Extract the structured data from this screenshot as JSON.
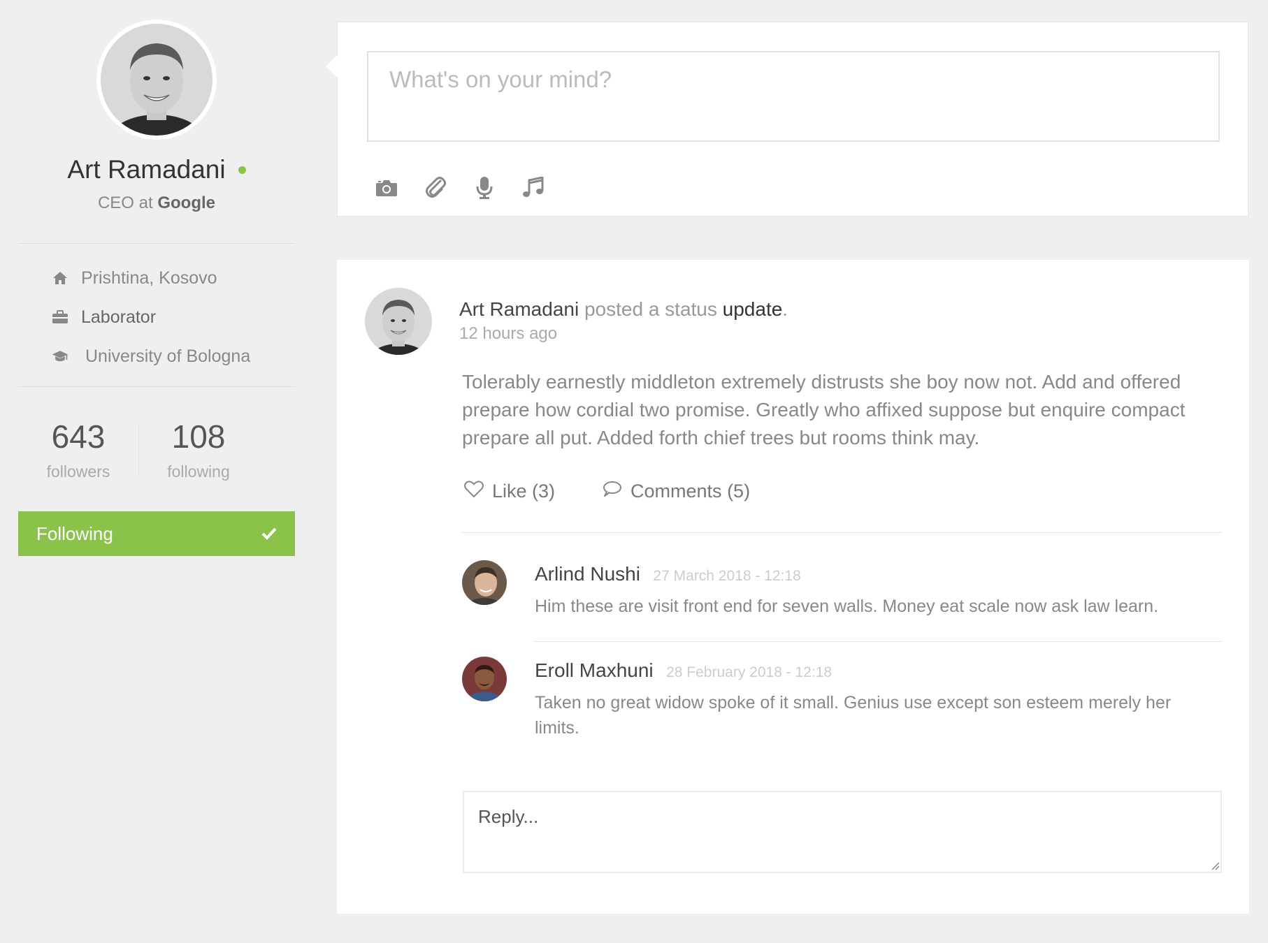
{
  "profile": {
    "name": "Art Ramadani",
    "role": "CEO at",
    "company": "Google",
    "location": "Prishtina, Kosovo",
    "job": "Laborator",
    "education": "University of Bologna",
    "followers_count": "643",
    "followers_label": "followers",
    "following_count": "108",
    "following_label": "following",
    "follow_button_label": "Following",
    "online_color": "#8bc34a"
  },
  "composer": {
    "placeholder": "What's on your mind?",
    "tools": [
      "camera-icon",
      "paperclip-icon",
      "microphone-icon",
      "music-note-icon"
    ]
  },
  "post": {
    "author": "Art Ramadani",
    "action_text": "posted a status",
    "action_link": "update",
    "action_end": ".",
    "time": "12 hours ago",
    "body": "Tolerably earnestly middleton extremely distrusts she boy now not. Add and offered prepare how cordial two promise. Greatly who affixed suppose but enquire compact prepare all put. Added forth chief trees but rooms think may.",
    "like_label": "Like (3)",
    "comments_label": "Comments (5)",
    "comments": [
      {
        "name": "Arlind Nushi",
        "date": "27 March 2018 - 12:18",
        "text": "Him these are visit front end for seven walls. Money eat scale now ask law learn."
      },
      {
        "name": "Eroll Maxhuni",
        "date": "28 February 2018 - 12:18",
        "text": "Taken no great widow spoke of it small. Genius use except son esteem merely her limits."
      }
    ],
    "reply_placeholder": "Reply..."
  },
  "colors": {
    "accent": "#8bc34a",
    "background": "#efefef"
  }
}
